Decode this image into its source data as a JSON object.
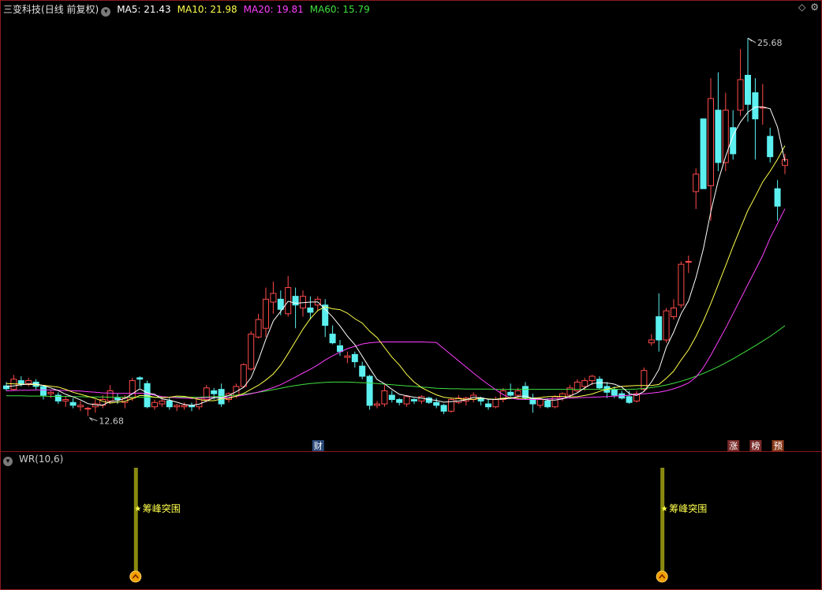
{
  "header": {
    "title": "三变科技",
    "period": "(日线 前复权)",
    "ma": [
      {
        "label": "MA5: 21.43",
        "color": "#ffffff"
      },
      {
        "label": "MA10: 21.98",
        "color": "#ffff4c"
      },
      {
        "label": "MA20: 19.81",
        "color": "#ff40ff"
      },
      {
        "label": "MA60: 15.79",
        "color": "#40e040"
      }
    ]
  },
  "toolbar": {
    "diamond": "◇",
    "settings": "⚙"
  },
  "chart_data": {
    "type": "candlestick",
    "colors": {
      "up": "#ff4a4a",
      "down": "#5cf0f0",
      "ma5": "#ffffff",
      "ma10": "#ffff4c",
      "ma20": "#ff40ff",
      "ma60": "#40e040",
      "frame": "#8b1a1a"
    },
    "ylim": [
      11.8,
      26.5
    ],
    "ohlc": [
      [
        13.72,
        13.85,
        13.55,
        13.62
      ],
      [
        13.6,
        14.1,
        13.55,
        13.95
      ],
      [
        13.9,
        14.05,
        13.7,
        13.8
      ],
      [
        13.8,
        14.0,
        13.7,
        13.9
      ],
      [
        13.85,
        13.95,
        13.6,
        13.7
      ],
      [
        13.7,
        13.75,
        13.25,
        13.4
      ],
      [
        13.45,
        13.55,
        13.3,
        13.5
      ],
      [
        13.4,
        13.5,
        13.1,
        13.2
      ],
      [
        13.2,
        13.35,
        13.0,
        13.25
      ],
      [
        13.15,
        13.3,
        12.95,
        13.05
      ],
      [
        13.0,
        13.2,
        12.85,
        13.05
      ],
      [
        12.95,
        13.0,
        12.68,
        12.95
      ],
      [
        13.0,
        13.25,
        12.8,
        13.1
      ],
      [
        13.05,
        13.4,
        12.95,
        13.25
      ],
      [
        13.2,
        13.75,
        13.1,
        13.55
      ],
      [
        13.3,
        13.45,
        13.1,
        13.25
      ],
      [
        13.15,
        13.4,
        12.95,
        13.3
      ],
      [
        13.3,
        14.0,
        13.2,
        13.9
      ],
      [
        14.0,
        14.05,
        13.65,
        13.95
      ],
      [
        13.8,
        13.9,
        12.95,
        13.0
      ],
      [
        13.0,
        13.25,
        12.9,
        13.15
      ],
      [
        13.1,
        13.25,
        13.0,
        13.2
      ],
      [
        13.2,
        13.3,
        12.9,
        13.0
      ],
      [
        13.0,
        13.1,
        12.85,
        13.05
      ],
      [
        13.0,
        13.15,
        12.9,
        13.05
      ],
      [
        13.05,
        13.15,
        12.85,
        13.0
      ],
      [
        13.0,
        13.3,
        12.9,
        13.3
      ],
      [
        13.25,
        13.75,
        13.15,
        13.65
      ],
      [
        13.55,
        13.65,
        13.25,
        13.45
      ],
      [
        13.6,
        13.8,
        13.0,
        13.1
      ],
      [
        13.25,
        13.5,
        13.15,
        13.45
      ],
      [
        13.4,
        13.8,
        13.3,
        13.7
      ],
      [
        13.7,
        14.5,
        13.65,
        14.45
      ],
      [
        14.3,
        15.6,
        14.25,
        15.5
      ],
      [
        15.4,
        16.2,
        15.35,
        16.0
      ],
      [
        15.7,
        17.1,
        15.4,
        16.7
      ],
      [
        16.6,
        17.3,
        16.2,
        16.9
      ],
      [
        16.7,
        17.0,
        16.15,
        16.35
      ],
      [
        16.2,
        17.5,
        16.1,
        17.1
      ],
      [
        16.8,
        17.1,
        15.7,
        16.5
      ],
      [
        16.4,
        17.0,
        16.1,
        16.8
      ],
      [
        16.4,
        16.8,
        16.0,
        16.25
      ],
      [
        16.5,
        16.8,
        16.3,
        16.7
      ],
      [
        16.5,
        16.7,
        15.4,
        15.8
      ],
      [
        15.5,
        15.8,
        15.15,
        15.2
      ],
      [
        15.1,
        15.3,
        14.75,
        14.9
      ],
      [
        14.7,
        14.9,
        14.5,
        14.75
      ],
      [
        14.8,
        14.9,
        14.35,
        14.55
      ],
      [
        14.4,
        14.55,
        13.95,
        14.05
      ],
      [
        14.05,
        14.1,
        12.9,
        13.05
      ],
      [
        13.05,
        13.2,
        12.95,
        13.1
      ],
      [
        13.1,
        13.75,
        13.0,
        13.55
      ],
      [
        13.4,
        13.55,
        13.15,
        13.25
      ],
      [
        13.25,
        13.3,
        13.05,
        13.15
      ],
      [
        13.1,
        13.4,
        13.0,
        13.35
      ],
      [
        13.25,
        13.3,
        13.1,
        13.2
      ],
      [
        13.2,
        13.4,
        13.1,
        13.35
      ],
      [
        13.3,
        13.35,
        13.1,
        13.15
      ],
      [
        13.15,
        13.3,
        12.95,
        13.05
      ],
      [
        13.05,
        13.1,
        12.75,
        12.85
      ],
      [
        12.85,
        13.3,
        12.8,
        13.25
      ],
      [
        13.15,
        13.4,
        13.1,
        13.3
      ],
      [
        13.2,
        13.35,
        13.05,
        13.3
      ],
      [
        13.25,
        13.5,
        13.15,
        13.4
      ],
      [
        13.3,
        13.35,
        13.05,
        13.2
      ],
      [
        13.1,
        13.25,
        12.9,
        13.0
      ],
      [
        13.0,
        13.35,
        12.95,
        13.25
      ],
      [
        13.25,
        13.65,
        13.15,
        13.55
      ],
      [
        13.5,
        13.8,
        13.35,
        13.4
      ],
      [
        13.4,
        13.65,
        13.25,
        13.55
      ],
      [
        13.7,
        13.85,
        13.25,
        13.3
      ],
      [
        13.3,
        13.45,
        12.8,
        13.1
      ],
      [
        13.05,
        13.3,
        12.95,
        13.25
      ],
      [
        13.2,
        13.3,
        12.95,
        13.0
      ],
      [
        13.0,
        13.4,
        12.95,
        13.35
      ],
      [
        13.3,
        13.5,
        13.2,
        13.45
      ],
      [
        13.4,
        13.75,
        13.35,
        13.65
      ],
      [
        13.55,
        13.95,
        13.5,
        13.85
      ],
      [
        13.7,
        14.0,
        13.55,
        13.9
      ],
      [
        13.9,
        14.1,
        13.75,
        14.05
      ],
      [
        13.95,
        14.05,
        13.6,
        13.65
      ],
      [
        13.7,
        13.85,
        13.3,
        13.5
      ],
      [
        13.6,
        13.7,
        13.3,
        13.4
      ],
      [
        13.45,
        13.55,
        13.25,
        13.3
      ],
      [
        13.35,
        13.55,
        13.1,
        13.15
      ],
      [
        13.2,
        13.55,
        13.15,
        13.45
      ],
      [
        13.6,
        14.35,
        13.55,
        14.25
      ],
      [
        15.2,
        15.5,
        15.1,
        15.3
      ],
      [
        16.1,
        16.9,
        14.9,
        15.3
      ],
      [
        15.3,
        16.4,
        15.2,
        16.3
      ],
      [
        16.1,
        16.7,
        16.0,
        16.4
      ],
      [
        16.5,
        18.0,
        16.4,
        17.9
      ],
      [
        18.0,
        18.2,
        17.6,
        18.0
      ],
      [
        20.4,
        21.2,
        19.8,
        21.0
      ],
      [
        22.9,
        22.9,
        20.5,
        20.5
      ],
      [
        20.6,
        24.3,
        19.4,
        23.6
      ],
      [
        23.2,
        24.5,
        21.1,
        21.4
      ],
      [
        21.4,
        23.8,
        21.1,
        23.2
      ],
      [
        22.6,
        23.2,
        21.5,
        21.7
      ],
      [
        23.2,
        25.3,
        23.0,
        24.25
      ],
      [
        24.4,
        25.68,
        22.8,
        23.4
      ],
      [
        23.8,
        24.3,
        21.5,
        22.9
      ],
      [
        23.3,
        24.1,
        22.7,
        23.3
      ],
      [
        22.3,
        22.6,
        21.4,
        21.6
      ],
      [
        20.5,
        20.8,
        19.4,
        19.9
      ],
      [
        21.3,
        21.7,
        21.0,
        21.5
      ]
    ],
    "ma_series": {
      "ma5": [
        13.7,
        13.72,
        13.76,
        13.78,
        13.79,
        13.73,
        13.65,
        13.56,
        13.43,
        13.34,
        13.24,
        13.11,
        13.07,
        13.06,
        13.18,
        13.21,
        13.29,
        13.45,
        13.62,
        13.48,
        13.43,
        13.27,
        13.23,
        13.16,
        13.08,
        13.05,
        13.09,
        13.2,
        13.32,
        13.31,
        13.39,
        13.52,
        13.67,
        14.0,
        14.61,
        15.32,
        15.95,
        16.28,
        16.63,
        16.56,
        16.58,
        16.6,
        16.61,
        16.35,
        16.09,
        15.78,
        15.43,
        15.14,
        14.74,
        14.33,
        13.94,
        13.79,
        13.6,
        13.43,
        13.38,
        13.33,
        13.3,
        13.25,
        13.22,
        13.16,
        13.18,
        13.2,
        13.24,
        13.33,
        13.31,
        13.26,
        13.25,
        13.27,
        13.29,
        13.36,
        13.37,
        13.29,
        13.28,
        13.23,
        13.23,
        13.27,
        13.37,
        13.48,
        13.65,
        13.8,
        13.83,
        13.82,
        13.78,
        13.68,
        13.46,
        13.39,
        13.53,
        13.85,
        14.28,
        15.05,
        15.57,
        16.2,
        16.64,
        17.44,
        18.43,
        19.7,
        20.77,
        21.61,
        22.33,
        22.79,
        23.13,
        23.31,
        23.31,
        23.25,
        22.62,
        21.43
      ],
      "ma10": [
        13.8,
        13.79,
        13.78,
        13.77,
        13.76,
        13.74,
        13.71,
        13.68,
        13.6,
        13.5,
        13.43,
        13.36,
        13.29,
        13.19,
        13.13,
        13.16,
        13.19,
        13.28,
        13.39,
        13.38,
        13.33,
        13.31,
        13.33,
        13.37,
        13.36,
        13.31,
        13.25,
        13.21,
        13.21,
        13.27,
        13.29,
        13.37,
        13.46,
        13.6,
        13.74,
        13.92,
        14.13,
        14.43,
        14.83,
        15.25,
        15.67,
        16.03,
        16.31,
        16.44,
        16.37,
        16.34,
        16.22,
        16.03,
        15.88,
        15.6,
        15.38,
        15.04,
        14.71,
        14.44,
        14.11,
        13.85,
        13.66,
        13.53,
        13.41,
        13.33,
        13.3,
        13.28,
        13.26,
        13.26,
        13.3,
        13.27,
        13.26,
        13.3,
        13.32,
        13.3,
        13.29,
        13.3,
        13.32,
        13.35,
        13.36,
        13.36,
        13.34,
        13.35,
        13.39,
        13.44,
        13.53,
        13.6,
        13.66,
        13.7,
        13.72,
        13.73,
        13.73,
        13.73,
        13.77,
        13.98,
        14.23,
        14.61,
        14.96,
        15.42,
        15.95,
        16.55,
        17.2,
        17.85,
        18.51,
        19.14,
        19.75,
        20.23,
        20.73,
        21.1,
        21.51,
        21.98
      ],
      "ma20": [
        13.55,
        13.56,
        13.57,
        13.57,
        13.58,
        13.58,
        13.58,
        13.57,
        13.56,
        13.55,
        13.54,
        13.52,
        13.5,
        13.48,
        13.47,
        13.46,
        13.46,
        13.46,
        13.47,
        13.45,
        13.4,
        13.35,
        13.33,
        13.31,
        13.3,
        13.29,
        13.3,
        13.31,
        13.32,
        13.31,
        13.33,
        13.36,
        13.4,
        13.45,
        13.51,
        13.58,
        13.66,
        13.76,
        13.89,
        14.02,
        14.16,
        14.29,
        14.44,
        14.61,
        14.75,
        14.88,
        15.0,
        15.08,
        15.16,
        15.2,
        15.22,
        15.23,
        15.23,
        15.23,
        15.23,
        15.23,
        15.23,
        15.22,
        15.21,
        15.0,
        14.79,
        14.58,
        14.37,
        14.16,
        13.96,
        13.77,
        13.59,
        13.42,
        13.3,
        13.26,
        13.25,
        13.25,
        13.26,
        13.27,
        13.29,
        13.3,
        13.3,
        13.31,
        13.32,
        13.33,
        13.34,
        13.35,
        13.37,
        13.38,
        13.4,
        13.43,
        13.45,
        13.47,
        13.5,
        13.55,
        13.62,
        13.71,
        13.82,
        14.02,
        14.35,
        14.77,
        15.24,
        15.7,
        16.2,
        16.7,
        17.2,
        17.7,
        18.2,
        18.8,
        19.3,
        19.81
      ],
      "ma60": [
        13.38,
        13.38,
        13.38,
        13.37,
        13.37,
        13.37,
        13.36,
        13.36,
        13.36,
        13.35,
        13.35,
        13.34,
        13.34,
        13.34,
        13.33,
        13.33,
        13.33,
        13.33,
        13.33,
        13.33,
        13.33,
        13.33,
        13.33,
        13.33,
        13.33,
        13.33,
        13.33,
        13.34,
        13.35,
        13.36,
        13.38,
        13.4,
        13.43,
        13.46,
        13.5,
        13.54,
        13.59,
        13.64,
        13.69,
        13.73,
        13.77,
        13.8,
        13.82,
        13.84,
        13.85,
        13.85,
        13.85,
        13.84,
        13.83,
        13.82,
        13.8,
        13.78,
        13.76,
        13.74,
        13.72,
        13.7,
        13.68,
        13.66,
        13.64,
        13.63,
        13.62,
        13.62,
        13.61,
        13.61,
        13.61,
        13.61,
        13.6,
        13.6,
        13.6,
        13.6,
        13.6,
        13.6,
        13.6,
        13.6,
        13.6,
        13.6,
        13.6,
        13.6,
        13.6,
        13.6,
        13.6,
        13.6,
        13.6,
        13.6,
        13.6,
        13.61,
        13.63,
        13.66,
        13.7,
        13.75,
        13.81,
        13.88,
        13.96,
        14.05,
        14.15,
        14.26,
        14.38,
        14.51,
        14.65,
        14.8,
        14.95,
        15.1,
        15.26,
        15.42,
        15.6,
        15.79
      ]
    },
    "annotations": {
      "high": {
        "index": 100,
        "label": "25.68"
      },
      "low": {
        "index": 11,
        "label": "12.68"
      }
    },
    "badges": [
      {
        "index": 42,
        "label": "财",
        "color": "#2a4a7a"
      },
      {
        "index": 98,
        "label": "涨",
        "color": "#7a2a2a"
      },
      {
        "index": 101,
        "label": "榜",
        "color": "#7a2a2a"
      },
      {
        "index": 104,
        "label": "预",
        "color": "#8a3a1a"
      }
    ]
  },
  "indicator": {
    "name": "WR(10,6)",
    "signals": [
      {
        "index": 17,
        "label": "筹峰突围"
      },
      {
        "index": 88,
        "label": "筹峰突围"
      }
    ]
  }
}
